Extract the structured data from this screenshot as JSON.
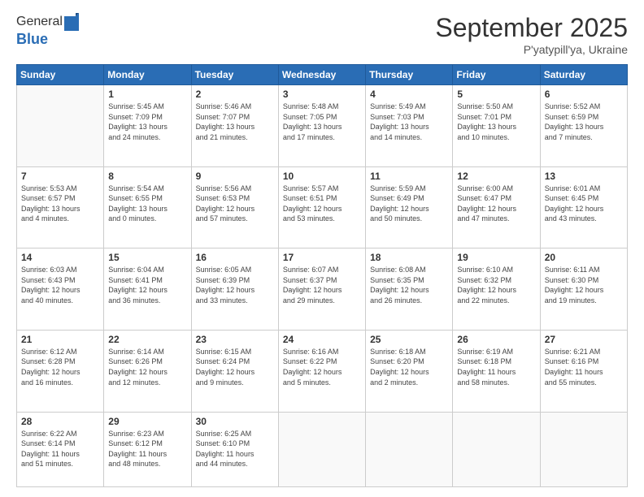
{
  "logo": {
    "general": "General",
    "blue": "Blue"
  },
  "header": {
    "title": "September 2025",
    "subtitle": "P'yatypill'ya, Ukraine"
  },
  "weekdays": [
    "Sunday",
    "Monday",
    "Tuesday",
    "Wednesday",
    "Thursday",
    "Friday",
    "Saturday"
  ],
  "weeks": [
    [
      {
        "day": "",
        "info": ""
      },
      {
        "day": "1",
        "info": "Sunrise: 5:45 AM\nSunset: 7:09 PM\nDaylight: 13 hours\nand 24 minutes."
      },
      {
        "day": "2",
        "info": "Sunrise: 5:46 AM\nSunset: 7:07 PM\nDaylight: 13 hours\nand 21 minutes."
      },
      {
        "day": "3",
        "info": "Sunrise: 5:48 AM\nSunset: 7:05 PM\nDaylight: 13 hours\nand 17 minutes."
      },
      {
        "day": "4",
        "info": "Sunrise: 5:49 AM\nSunset: 7:03 PM\nDaylight: 13 hours\nand 14 minutes."
      },
      {
        "day": "5",
        "info": "Sunrise: 5:50 AM\nSunset: 7:01 PM\nDaylight: 13 hours\nand 10 minutes."
      },
      {
        "day": "6",
        "info": "Sunrise: 5:52 AM\nSunset: 6:59 PM\nDaylight: 13 hours\nand 7 minutes."
      }
    ],
    [
      {
        "day": "7",
        "info": "Sunrise: 5:53 AM\nSunset: 6:57 PM\nDaylight: 13 hours\nand 4 minutes."
      },
      {
        "day": "8",
        "info": "Sunrise: 5:54 AM\nSunset: 6:55 PM\nDaylight: 13 hours\nand 0 minutes."
      },
      {
        "day": "9",
        "info": "Sunrise: 5:56 AM\nSunset: 6:53 PM\nDaylight: 12 hours\nand 57 minutes."
      },
      {
        "day": "10",
        "info": "Sunrise: 5:57 AM\nSunset: 6:51 PM\nDaylight: 12 hours\nand 53 minutes."
      },
      {
        "day": "11",
        "info": "Sunrise: 5:59 AM\nSunset: 6:49 PM\nDaylight: 12 hours\nand 50 minutes."
      },
      {
        "day": "12",
        "info": "Sunrise: 6:00 AM\nSunset: 6:47 PM\nDaylight: 12 hours\nand 47 minutes."
      },
      {
        "day": "13",
        "info": "Sunrise: 6:01 AM\nSunset: 6:45 PM\nDaylight: 12 hours\nand 43 minutes."
      }
    ],
    [
      {
        "day": "14",
        "info": "Sunrise: 6:03 AM\nSunset: 6:43 PM\nDaylight: 12 hours\nand 40 minutes."
      },
      {
        "day": "15",
        "info": "Sunrise: 6:04 AM\nSunset: 6:41 PM\nDaylight: 12 hours\nand 36 minutes."
      },
      {
        "day": "16",
        "info": "Sunrise: 6:05 AM\nSunset: 6:39 PM\nDaylight: 12 hours\nand 33 minutes."
      },
      {
        "day": "17",
        "info": "Sunrise: 6:07 AM\nSunset: 6:37 PM\nDaylight: 12 hours\nand 29 minutes."
      },
      {
        "day": "18",
        "info": "Sunrise: 6:08 AM\nSunset: 6:35 PM\nDaylight: 12 hours\nand 26 minutes."
      },
      {
        "day": "19",
        "info": "Sunrise: 6:10 AM\nSunset: 6:32 PM\nDaylight: 12 hours\nand 22 minutes."
      },
      {
        "day": "20",
        "info": "Sunrise: 6:11 AM\nSunset: 6:30 PM\nDaylight: 12 hours\nand 19 minutes."
      }
    ],
    [
      {
        "day": "21",
        "info": "Sunrise: 6:12 AM\nSunset: 6:28 PM\nDaylight: 12 hours\nand 16 minutes."
      },
      {
        "day": "22",
        "info": "Sunrise: 6:14 AM\nSunset: 6:26 PM\nDaylight: 12 hours\nand 12 minutes."
      },
      {
        "day": "23",
        "info": "Sunrise: 6:15 AM\nSunset: 6:24 PM\nDaylight: 12 hours\nand 9 minutes."
      },
      {
        "day": "24",
        "info": "Sunrise: 6:16 AM\nSunset: 6:22 PM\nDaylight: 12 hours\nand 5 minutes."
      },
      {
        "day": "25",
        "info": "Sunrise: 6:18 AM\nSunset: 6:20 PM\nDaylight: 12 hours\nand 2 minutes."
      },
      {
        "day": "26",
        "info": "Sunrise: 6:19 AM\nSunset: 6:18 PM\nDaylight: 11 hours\nand 58 minutes."
      },
      {
        "day": "27",
        "info": "Sunrise: 6:21 AM\nSunset: 6:16 PM\nDaylight: 11 hours\nand 55 minutes."
      }
    ],
    [
      {
        "day": "28",
        "info": "Sunrise: 6:22 AM\nSunset: 6:14 PM\nDaylight: 11 hours\nand 51 minutes."
      },
      {
        "day": "29",
        "info": "Sunrise: 6:23 AM\nSunset: 6:12 PM\nDaylight: 11 hours\nand 48 minutes."
      },
      {
        "day": "30",
        "info": "Sunrise: 6:25 AM\nSunset: 6:10 PM\nDaylight: 11 hours\nand 44 minutes."
      },
      {
        "day": "",
        "info": ""
      },
      {
        "day": "",
        "info": ""
      },
      {
        "day": "",
        "info": ""
      },
      {
        "day": "",
        "info": ""
      }
    ]
  ]
}
